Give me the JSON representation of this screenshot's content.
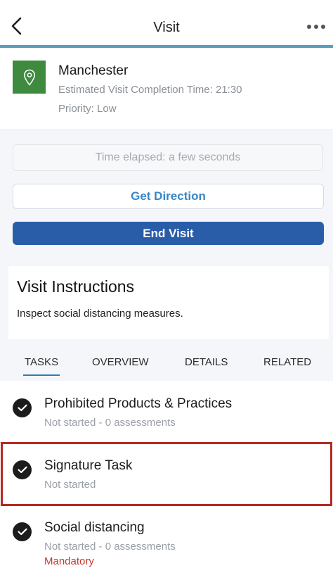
{
  "header": {
    "title": "Visit",
    "back_icon": "chevron-left-icon",
    "more_icon": "more-horizontal-icon",
    "accent_color": "#5b9bbc"
  },
  "location": {
    "icon": "location-pin-icon",
    "icon_bg": "#3e8a3e",
    "name": "Manchester",
    "eta": "Estimated Visit Completion Time: 21:30",
    "priority": "Priority: Low"
  },
  "actions": {
    "time_elapsed": "Time elapsed:  a few seconds",
    "get_direction": "Get Direction",
    "end_visit": "End Visit",
    "end_visit_color": "#2a5da8"
  },
  "instructions": {
    "title": "Visit Instructions",
    "text": "Inspect social distancing measures."
  },
  "tabs": [
    {
      "label": "TASKS",
      "active": true
    },
    {
      "label": "OVERVIEW",
      "active": false
    },
    {
      "label": "DETAILS",
      "active": false
    },
    {
      "label": "RELATED",
      "active": false
    }
  ],
  "tasks": [
    {
      "title": "Prohibited Products & Practices",
      "status": "Not started - 0 assessments",
      "mandatory": ""
    },
    {
      "title": "Signature Task",
      "status": "Not started",
      "mandatory": ""
    },
    {
      "title": "Social distancing",
      "status": "Not started - 0 assessments",
      "mandatory": "Mandatory"
    }
  ]
}
